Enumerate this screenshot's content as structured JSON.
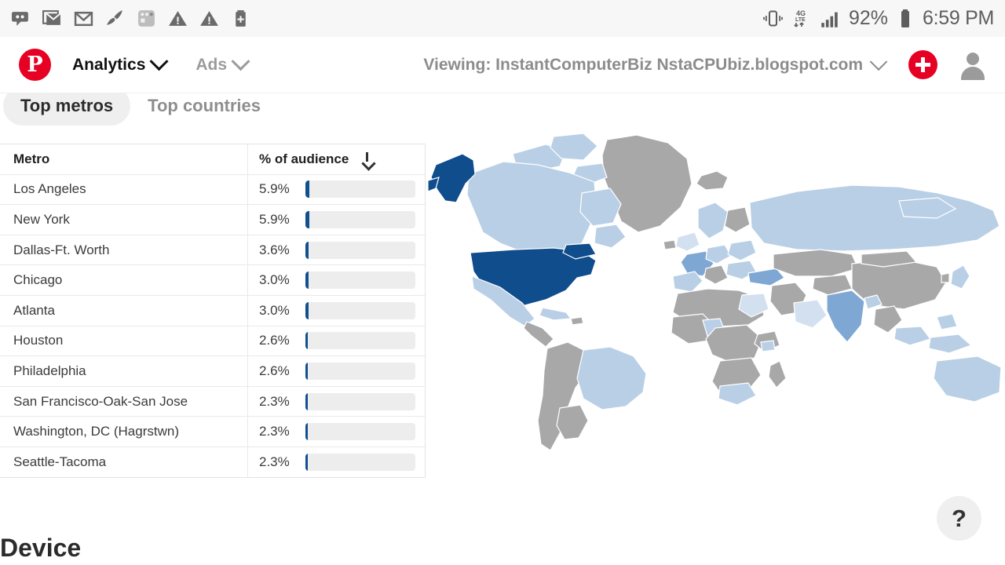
{
  "statusbar": {
    "icons_left": [
      "voicemail-icon",
      "gmail-stack-icon",
      "gmail-icon",
      "cleaner-icon",
      "apps-icon",
      "warning-icon",
      "warning-icon",
      "battery-plus-icon"
    ],
    "vibrate_icon": "vibrate-icon",
    "network_label": "4G LTE",
    "signal_icon": "signal-bars-icon",
    "battery_percent": "92%",
    "battery_icon": "battery-icon",
    "time": "6:59 PM"
  },
  "header": {
    "logo_letter": "P",
    "nav": [
      {
        "label": "Analytics",
        "active": true
      },
      {
        "label": "Ads",
        "active": false
      }
    ],
    "viewing_label": "Viewing: InstantComputerBiz NstaCPUbiz.blogspot.com",
    "create_button": "create-pin-button",
    "avatar": "user-avatar"
  },
  "tabs": [
    {
      "label": "Top metros",
      "active": true
    },
    {
      "label": "Top countries",
      "active": false
    }
  ],
  "table": {
    "columns": [
      "Metro",
      "% of audience"
    ],
    "sort_column": "% of audience",
    "sort_direction": "descending",
    "rows": [
      {
        "metro": "Los Angeles",
        "pct": "5.9%",
        "value": 5.9
      },
      {
        "metro": "New York",
        "pct": "5.9%",
        "value": 5.9
      },
      {
        "metro": "Dallas-Ft. Worth",
        "pct": "3.6%",
        "value": 3.6
      },
      {
        "metro": "Chicago",
        "pct": "3.0%",
        "value": 3.0
      },
      {
        "metro": "Atlanta",
        "pct": "3.0%",
        "value": 3.0
      },
      {
        "metro": "Houston",
        "pct": "2.6%",
        "value": 2.6
      },
      {
        "metro": "Philadelphia",
        "pct": "2.6%",
        "value": 2.6
      },
      {
        "metro": "San Francisco-Oak-San Jose",
        "pct": "2.3%",
        "value": 2.3
      },
      {
        "metro": "Washington, DC (Hagrstwn)",
        "pct": "2.3%",
        "value": 2.3
      },
      {
        "metro": "Seattle-Tacoma",
        "pct": "2.3%",
        "value": 2.3
      }
    ]
  },
  "map": {
    "type": "choropleth-world",
    "highlight_country": "United States",
    "colors": {
      "highest": "#0f4d8c",
      "mid": "#7fa7d4",
      "low": "#b9cfe6",
      "lowest": "#d2e0ef",
      "no_data": "#a8a8a8",
      "ocean": "#ffffff"
    }
  },
  "help_button": {
    "label": "?"
  },
  "section": {
    "device_heading": "Device"
  },
  "accent_colors": {
    "pinterest_red": "#e60023",
    "bar_blue": "#11508f",
    "bar_track": "#ededed"
  }
}
